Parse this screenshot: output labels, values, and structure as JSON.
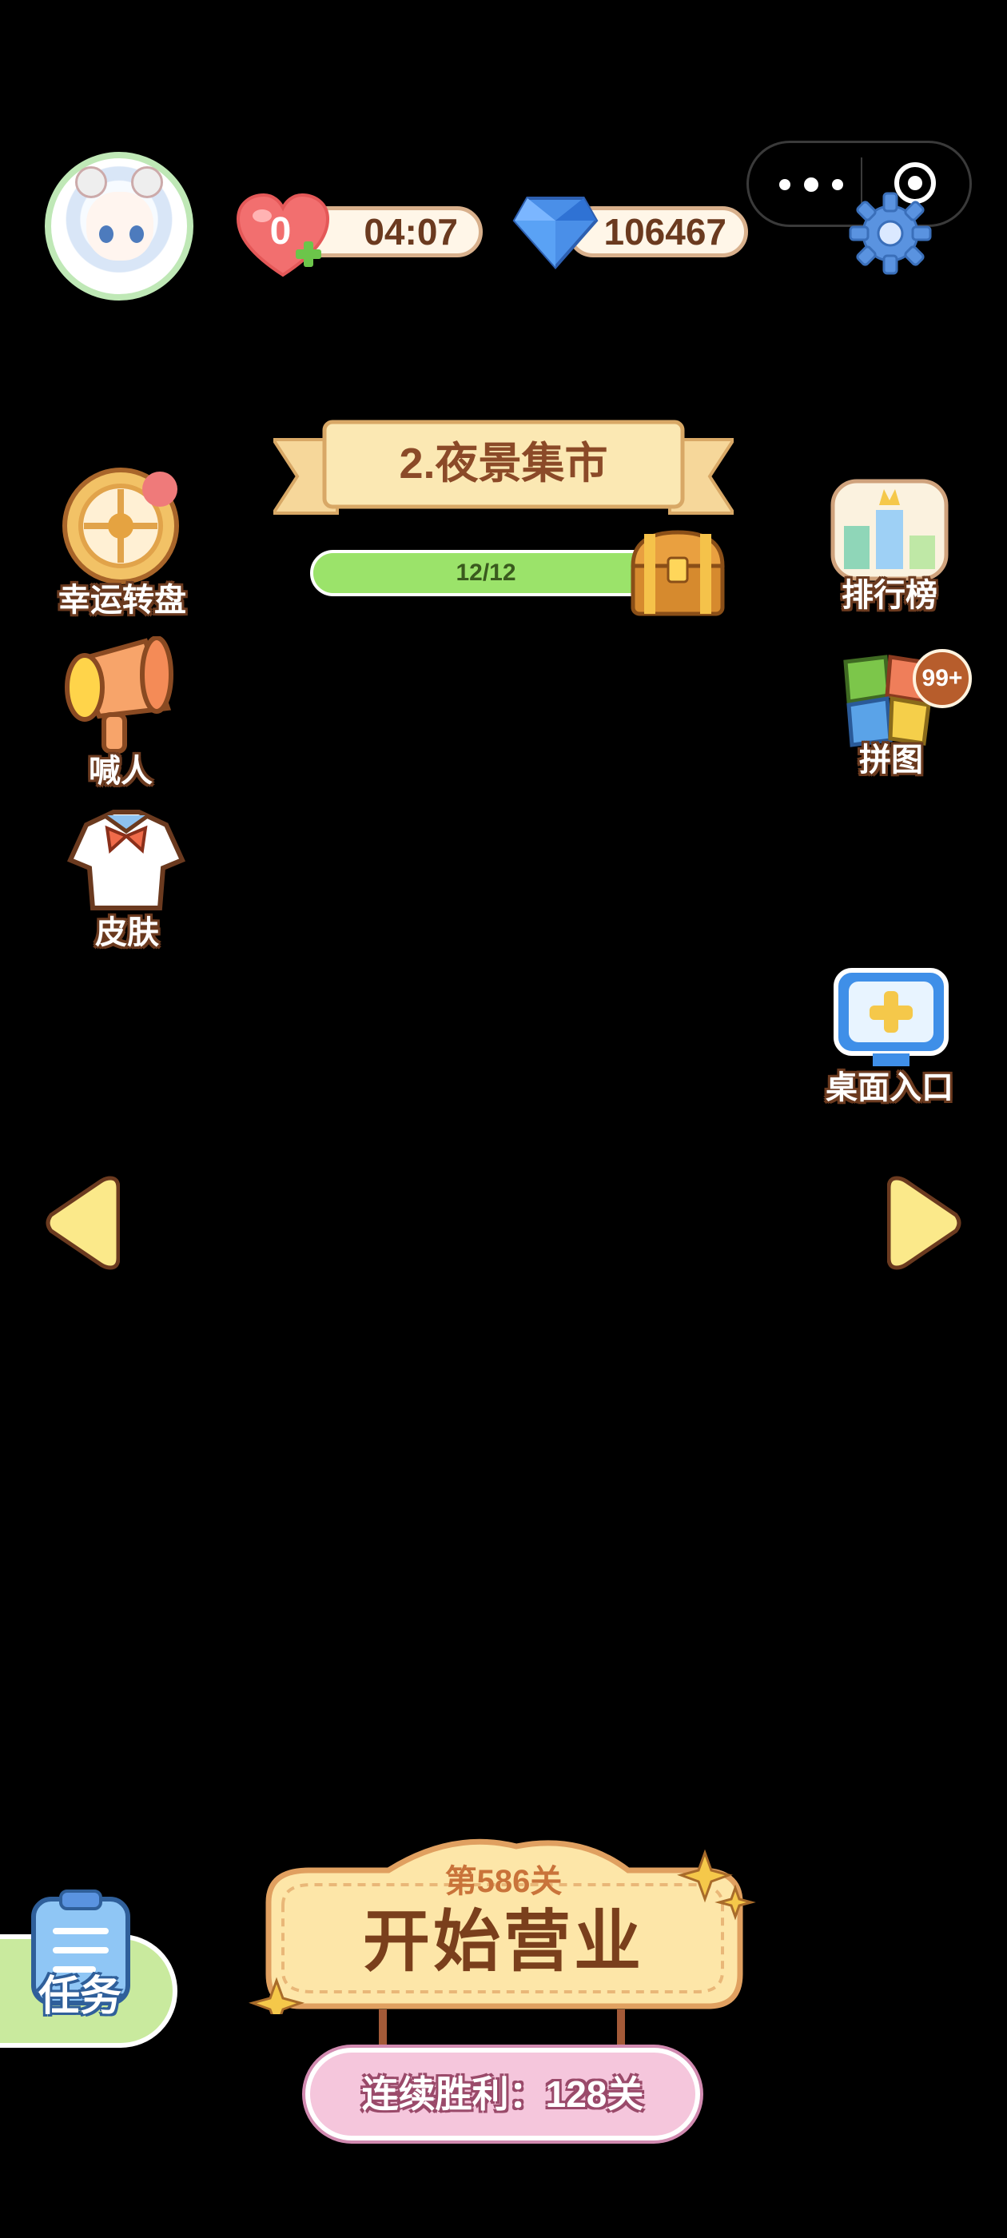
{
  "status": {
    "lives": "0",
    "timer": "04:07",
    "gems": "106467"
  },
  "level": {
    "name": "2.夜景集市",
    "progress_text": "12/12",
    "progress_fraction": 1.0
  },
  "left_menu": [
    {
      "label": "幸运转盘",
      "icon": "lucky-wheel-icon"
    },
    {
      "label": "喊人",
      "icon": "megaphone-icon"
    },
    {
      "label": "皮肤",
      "icon": "shirt-icon"
    }
  ],
  "right_menu": [
    {
      "label": "排行榜",
      "icon": "trophy-icon"
    },
    {
      "label": "拼图",
      "icon": "puzzle-icon",
      "badge": "99+"
    },
    {
      "label": "桌面入口",
      "icon": "desktop-add-icon"
    }
  ],
  "start": {
    "level_label": "第586关",
    "button_label": "开始营业",
    "streak_label": "连续胜利：128关"
  },
  "tasks": {
    "label": "任务"
  },
  "colors": {
    "background": "#000000",
    "accent_brown": "#8b4a28",
    "progress_green": "#9be36a",
    "streak_pink": "#f5c6dc"
  }
}
